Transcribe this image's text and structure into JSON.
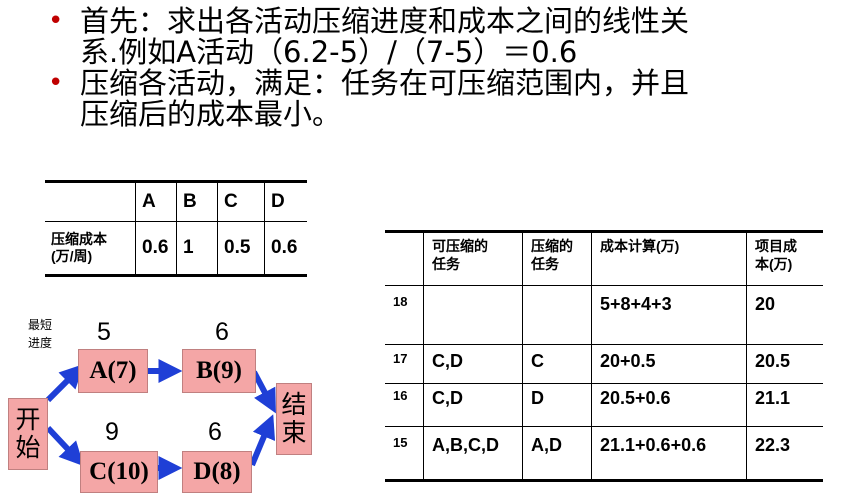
{
  "bullets": [
    {
      "line1": "首先：求出各活动压缩进度和成本之间的线性关",
      "line2": "系.例如A活动（6.2-5）/（7-5）＝0.6"
    },
    {
      "line1": "压缩各活动，满足：任务在可压缩范围内，并且",
      "line2": "压缩后的成本最小。"
    }
  ],
  "table1": {
    "headers": [
      "",
      "A",
      "B",
      "C",
      "D"
    ],
    "row_label_line1": "压缩成本",
    "row_label_line2": "(万/周)",
    "values": [
      "0.6",
      "1",
      "0.5",
      "0.6"
    ]
  },
  "table2": {
    "headers": [
      {
        "l1": "",
        "l2": ""
      },
      {
        "l1": "可压缩的",
        "l2": "任务"
      },
      {
        "l1": "压缩的",
        "l2": "任务"
      },
      {
        "l1": "成本计算(万)",
        "l2": ""
      },
      {
        "l1": "项目成",
        "l2": "本(万)"
      }
    ],
    "rows": [
      [
        "18",
        "",
        "",
        "5+8+4+3",
        "20"
      ],
      [
        "17",
        "C,D",
        "C",
        "20+0.5",
        "20.5"
      ],
      [
        "16",
        "C,D",
        "D",
        "20.5+0.6",
        "21.1"
      ],
      [
        "15",
        "A,B,C,D",
        "A,D",
        "21.1+0.6+0.6",
        "22.3"
      ]
    ]
  },
  "diagram": {
    "note_line1": "最短",
    "note_line2": "进度",
    "start": "开始",
    "start_l1": "开",
    "start_l2": "始",
    "end_l1": "结",
    "end_l2": "束",
    "nodes": {
      "a": "A(7)",
      "b": "B(9)",
      "c": "C(10)",
      "d": "D(8)"
    },
    "nums": {
      "a": "5",
      "b": "6",
      "c": "9",
      "d": "6"
    },
    "node_color": "#f4a6a6",
    "arrow_color": "#1f3fd6"
  }
}
